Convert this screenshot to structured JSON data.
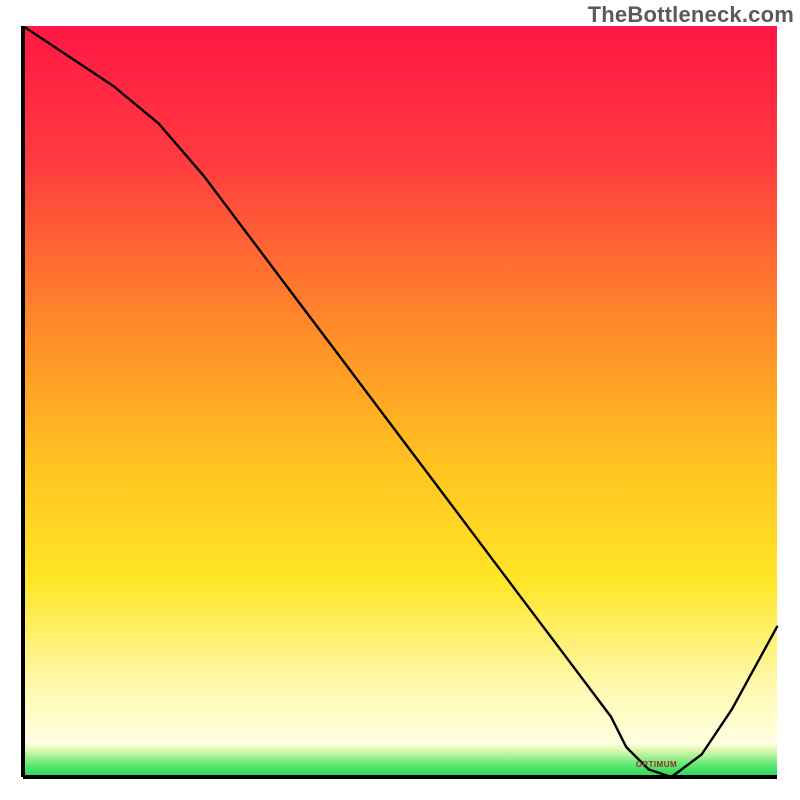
{
  "watermark": "TheBottleneck.com",
  "marker_label": "OPTIMUM",
  "chart_data": {
    "type": "line",
    "title": "",
    "xlabel": "",
    "ylabel": "",
    "xlim": [
      0,
      100
    ],
    "ylim": [
      0,
      100
    ],
    "grid": false,
    "legend": false,
    "background": {
      "type": "vertical-gradient",
      "description": "top red → orange → yellow → pale-yellow → thin green band at bottom",
      "stops": [
        {
          "pos": 0.0,
          "color": "#ff1744"
        },
        {
          "pos": 0.18,
          "color": "#ff3b3f"
        },
        {
          "pos": 0.4,
          "color": "#ff8a2a"
        },
        {
          "pos": 0.58,
          "color": "#ffc220"
        },
        {
          "pos": 0.74,
          "color": "#ffe627"
        },
        {
          "pos": 0.88,
          "color": "#fff9b0"
        },
        {
          "pos": 0.955,
          "color": "#ffffe0"
        },
        {
          "pos": 0.965,
          "color": "#d9f7b0"
        },
        {
          "pos": 0.985,
          "color": "#57e86e"
        },
        {
          "pos": 1.0,
          "color": "#2bd65a"
        }
      ]
    },
    "axes": {
      "show_ticks": false,
      "line_color": "#000000",
      "line_width": 3
    },
    "series": [
      {
        "name": "bottleneck-curve",
        "color": "#000000",
        "width": 2.4,
        "x": [
          0,
          6,
          12,
          18,
          24,
          30,
          36,
          42,
          48,
          54,
          60,
          66,
          72,
          78,
          80,
          83,
          86,
          90,
          94,
          100
        ],
        "y": [
          100,
          96,
          92,
          87,
          80,
          72,
          64,
          56,
          48,
          40,
          32,
          24,
          16,
          8,
          4,
          1,
          0,
          3,
          9,
          20
        ]
      }
    ],
    "annotations": [
      {
        "name": "optimum-marker",
        "text_ref": "marker_label",
        "x": 85,
        "y": 1.5,
        "color": "#a82828"
      }
    ]
  }
}
